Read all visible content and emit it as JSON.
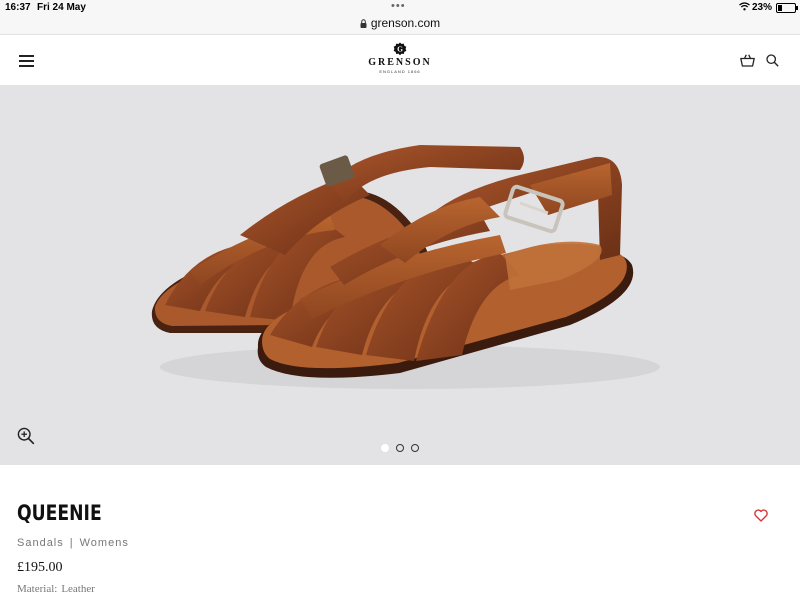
{
  "status_bar": {
    "time": "16:37",
    "date": "Fri 24 May",
    "url": "grenson.com",
    "battery": "23%",
    "battery_level": 0.23
  },
  "header": {
    "brand": "GRENSON",
    "tagline": "ENGLAND 1866",
    "emblem_letter": "G",
    "icons": [
      "menu-icon",
      "basket-icon",
      "search-icon"
    ]
  },
  "gallery": {
    "image_count": 3,
    "active_index": 0,
    "zoom_icon": "zoom-in-icon",
    "background": "#e3e3e5"
  },
  "product": {
    "name": "QUEENIE",
    "category": "Sandals",
    "gender": "Womens",
    "separator": "|",
    "price": "£195.00",
    "material_label": "Material:",
    "material_value": "Leather",
    "wishlist_icon": "heart-icon",
    "accent_color": "#d4373a"
  }
}
